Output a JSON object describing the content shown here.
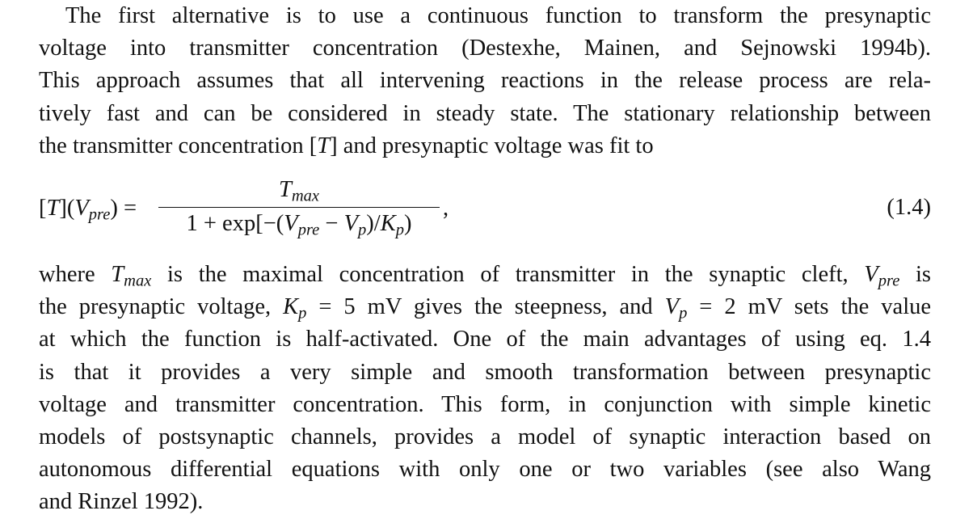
{
  "paragraph_1": {
    "lines": [
      "The first alternative is to use a continuous function to transform the presynaptic",
      "voltage into transmitter concentration (Destexhe, Mainen, and Sejnowski 1994b).",
      "This approach assumes that all intervening reactions in the release process are rela-",
      "tively fast and can be considered in steady state. The stationary relationship between"
    ],
    "last_line_prefix": "the transmitter concentration [",
    "last_line_var": "T",
    "last_line_suffix": "] and presynaptic voltage was fit to"
  },
  "equation": {
    "lhs_open": "[",
    "lhs_T": "T",
    "lhs_mid": "](",
    "lhs_V": "V",
    "lhs_V_sub": "pre",
    "lhs_close": ") =",
    "num_T": "T",
    "num_sub": "max",
    "den_a": "1 + exp[−(",
    "den_V1": "V",
    "den_V1_sub": "pre",
    "den_minus": " − ",
    "den_V2": "V",
    "den_V2_sub": "p",
    "den_b": ")/",
    "den_K": "K",
    "den_K_sub": "p",
    "den_c": ")",
    "comma": ",",
    "number": "(1.4)"
  },
  "paragraph_2": {
    "line1": {
      "a": "where ",
      "T": "T",
      "T_sub": "max",
      "b": " is the maximal concentration of transmitter in the synaptic cleft, ",
      "V": "V",
      "V_sub": "pre",
      "c": " is"
    },
    "line2": {
      "a": "the presynaptic voltage, ",
      "K": "K",
      "K_sub": "p",
      "b": " = 5 mV gives the steepness, and ",
      "V": "V",
      "V_sub": "p",
      "c": " = 2 mV sets the value"
    },
    "lines": [
      "at which the function is half-activated. One of the main advantages of using eq. 1.4",
      "is that it provides a very simple and smooth transformation between presynaptic",
      "voltage and transmitter concentration. This form, in conjunction with simple kinetic",
      "models of postsynaptic channels, provides a model of synaptic interaction based on",
      "autonomous differential equations with only one or two variables (see also Wang"
    ],
    "last_line": "and Rinzel 1992)."
  }
}
